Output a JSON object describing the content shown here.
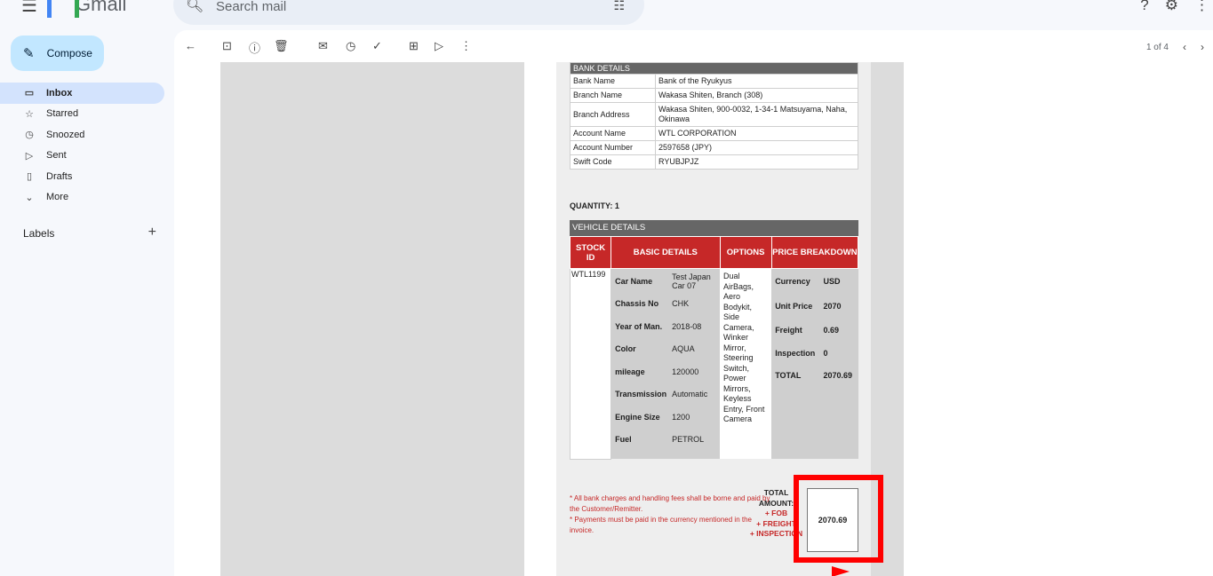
{
  "header": {
    "app_name": "Gmail",
    "search_placeholder": "Search mail"
  },
  "sidebar": {
    "compose_label": "Compose",
    "items": [
      {
        "label": "Inbox",
        "icon": "inbox-icon",
        "active": true
      },
      {
        "label": "Starred",
        "icon": "star-icon"
      },
      {
        "label": "Snoozed",
        "icon": "clock-icon"
      },
      {
        "label": "Sent",
        "icon": "send-icon"
      },
      {
        "label": "Drafts",
        "icon": "draft-icon"
      },
      {
        "label": "More",
        "icon": "chevron-down-icon"
      }
    ],
    "labels_title": "Labels"
  },
  "toolbar": {
    "pager_text": "1 of 4"
  },
  "invoice": {
    "bank": {
      "title": "BANK DETAILS",
      "rows": [
        {
          "k": "Bank Name",
          "v": "Bank of the Ryukyus"
        },
        {
          "k": "Branch Name",
          "v": "Wakasa Shiten, Branch (308)"
        },
        {
          "k": "Branch Address",
          "v": "Wakasa Shiten, 900-0032, 1-34-1 Matsuyama, Naha, Okinawa"
        },
        {
          "k": "Account Name",
          "v": "WTL CORPORATION"
        },
        {
          "k": "Account Number",
          "v": "2597658 (JPY)"
        },
        {
          "k": "Swift Code",
          "v": "RYUBJPJZ"
        }
      ]
    },
    "quantity": "QUANTITY: 1",
    "vehicle": {
      "title": "VEHICLE DETAILS",
      "headers": {
        "stock": "STOCK ID",
        "basic": "BASIC DETAILS",
        "options": "OPTIONS",
        "price": "PRICE BREAKDOWN"
      },
      "stock_id": "WTL1199",
      "basic": [
        {
          "k": "Car Name",
          "v": "Test Japan Car 07"
        },
        {
          "k": "Chassis No",
          "v": "CHK"
        },
        {
          "k": "Year of Man.",
          "v": "2018-08"
        },
        {
          "k": "Color",
          "v": "AQUA"
        },
        {
          "k": "mileage",
          "v": "120000"
        },
        {
          "k": "Transmission",
          "v": "Automatic"
        },
        {
          "k": "Engine Size",
          "v": "1200"
        },
        {
          "k": "Fuel",
          "v": "PETROL"
        }
      ],
      "options": "Dual AirBags, Aero Bodykit, Side Camera, Winker Mirror, Steering Switch, Power Mirrors, Keyless Entry, Front Camera",
      "price": [
        {
          "k": "Currency",
          "v": "USD"
        },
        {
          "k": "Unit Price",
          "v": "2070"
        },
        {
          "k": "Freight",
          "v": "0.69"
        },
        {
          "k": "Inspection",
          "v": "0"
        },
        {
          "k": "TOTAL",
          "v": "2070.69"
        }
      ]
    },
    "notes": {
      "line1": "* All bank charges and handling fees shall be borne and paid by the Customer/Remitter.",
      "line2": "* Payments must be paid in the currency mentioned in the invoice."
    },
    "total": {
      "label1": "TOTAL",
      "label2": "AMOUNT:",
      "fob": "+ FOB",
      "freight": "+ FREIGHT",
      "inspection": "+ INSPECTION",
      "value": "2070.69"
    }
  },
  "colors": {
    "highlight": "#ff0000",
    "table_header_red": "#c62828",
    "section_header_gray": "#666666",
    "compose_bg": "#c2e7ff",
    "inbox_active_bg": "#d3e3fd"
  }
}
